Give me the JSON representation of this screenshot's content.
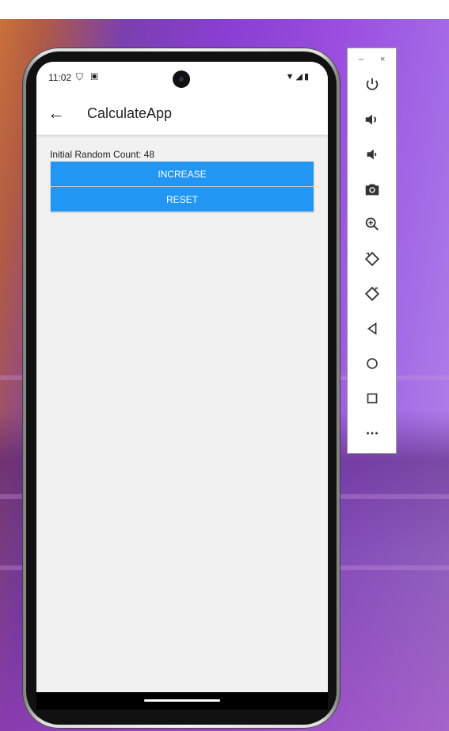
{
  "status_bar": {
    "time": "11:02",
    "left_icons": "⛉ ▣",
    "right_icons": "▼◢▮"
  },
  "app_bar": {
    "back_icon": "←",
    "title": "CalculateApp"
  },
  "content": {
    "count_text": "Initial Random Count: 48",
    "increase_label": "INCREASE",
    "reset_label": "RESET"
  },
  "emulator_panel": {
    "minimize": "–",
    "close": "×",
    "tools": [
      "power-icon",
      "volume-up-icon",
      "volume-down-icon",
      "camera-icon",
      "zoom-icon",
      "rotate-left-icon",
      "rotate-right-icon",
      "back-icon",
      "home-icon",
      "overview-icon",
      "more-icon"
    ]
  },
  "colors": {
    "button": "#2196f3",
    "appbar": "#ffffff",
    "screen_bg": "#f1f1f1"
  }
}
